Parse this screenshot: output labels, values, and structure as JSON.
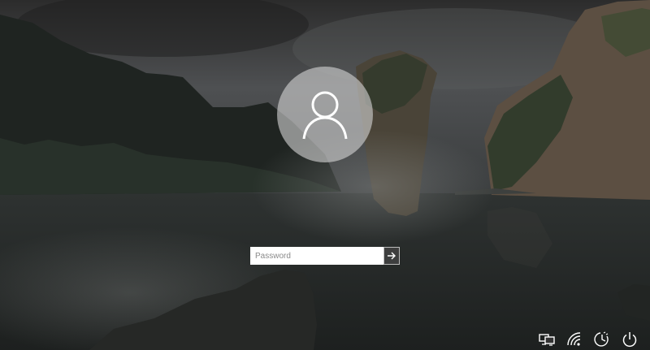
{
  "login": {
    "username": "",
    "password_value": "",
    "password_placeholder": "Password"
  },
  "icons": {
    "avatar": "user-silhouette-icon",
    "submit": "arrow-right-icon",
    "tray": [
      "network-icon",
      "wifi-icon",
      "ease-of-access-icon",
      "power-icon"
    ]
  },
  "colors": {
    "avatar_bg": "#d2d2d2",
    "input_bg": "#ffffff",
    "submit_bg": "#464646",
    "icon": "#ffffff"
  }
}
